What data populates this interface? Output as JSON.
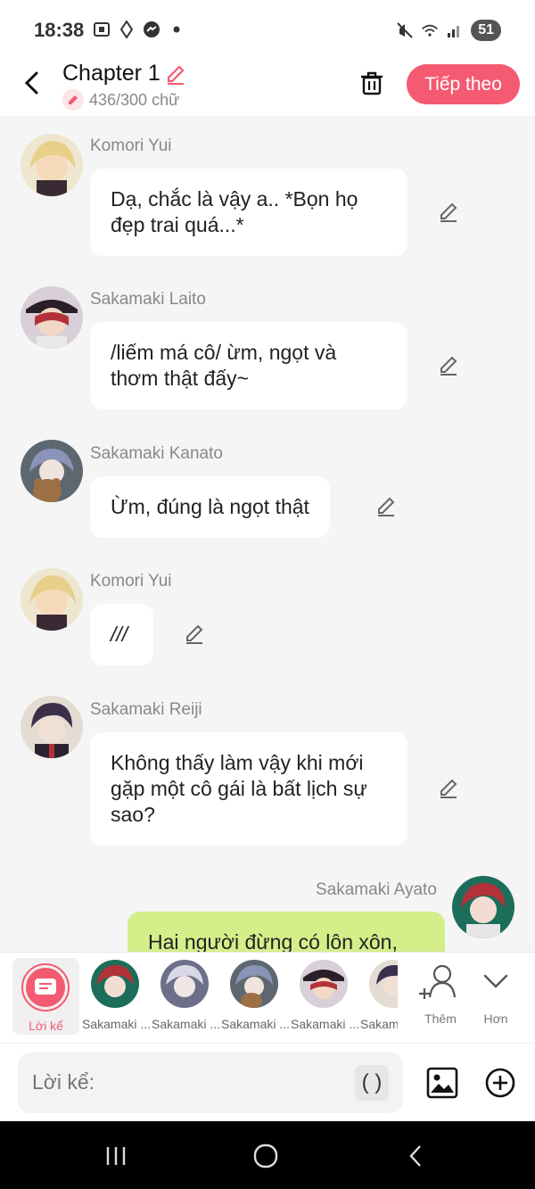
{
  "status": {
    "time": "18:38",
    "battery": "51",
    "icons_left": [
      "screenshot-icon",
      "location-icon",
      "messenger-icon",
      "dot-icon"
    ],
    "icons_right": [
      "mute-icon",
      "wifi-icon",
      "signal-icon"
    ]
  },
  "header": {
    "title": "Chapter 1",
    "word_count": "436/300 chữ",
    "next_label": "Tiếp theo"
  },
  "messages": [
    {
      "name": "Komori Yui",
      "text": "Dạ, chắc là vậy a.. *Bọn họ đẹp trai quá...*"
    },
    {
      "name": "Sakamaki Laito",
      "text": "/liếm má cô/ ừm, ngọt và thơm thật đấy~"
    },
    {
      "name": "Sakamaki Kanato",
      "text": "Ừm, đúng là ngọt thật"
    },
    {
      "name": "Komori Yui",
      "text": "///"
    },
    {
      "name": "Sakamaki Reiji",
      "text": "Không thấy làm vậy khi mới gặp một cô gái là bất lịch sự sao?"
    },
    {
      "name": "Sakamaki Ayato",
      "text": "Hai người đừng có lôn xôn,"
    }
  ],
  "character_bar": {
    "narrator_label": "Lời kể",
    "characters": [
      {
        "label": "Sakamaki ..."
      },
      {
        "label": "Sakamaki ..."
      },
      {
        "label": "Sakamaki ..."
      },
      {
        "label": "Sakamaki ..."
      },
      {
        "label": "Sakam"
      }
    ],
    "add_label": "Thêm",
    "more_label": "Hơn"
  },
  "composer": {
    "placeholder": "Lời kể:",
    "paren_label": "( )"
  },
  "colors": {
    "accent": "#f45a72",
    "my_bubble": "#d4ee8a",
    "bubble": "#ffffff",
    "background": "#f5f5f5"
  }
}
